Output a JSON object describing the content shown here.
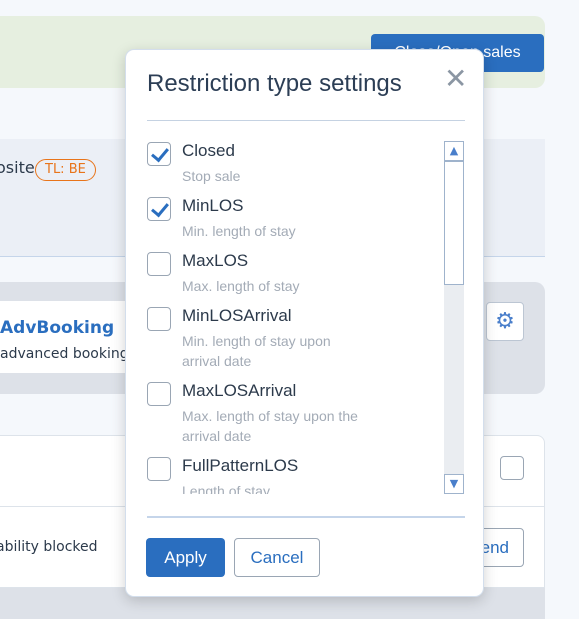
{
  "background": {
    "sales_button": "Close/Open sales",
    "site_text": "osite",
    "badge": "TL: BE",
    "card_title": "AdvBooking",
    "card_subtitle": "advanced booking",
    "row_text": "ability blocked",
    "row_button": "end",
    "gear_icon": "gear-icon"
  },
  "modal": {
    "title": "Restriction type settings",
    "close_icon": "close-icon",
    "items": [
      {
        "label": "Closed",
        "description": "Stop sale",
        "checked": true
      },
      {
        "label": "MinLOS",
        "description": "Min. length of stay",
        "checked": true
      },
      {
        "label": "MaxLOS",
        "description": "Max. length of stay",
        "checked": false
      },
      {
        "label": "MinLOSArrival",
        "description": "Min. length of stay upon arrival date",
        "checked": false
      },
      {
        "label": "MaxLOSArrival",
        "description": "Max. length of stay upon the arrival date",
        "checked": false
      },
      {
        "label": "FullPatternLOS",
        "description": "Length of stay",
        "checked": false
      }
    ],
    "apply_label": "Apply",
    "cancel_label": "Cancel"
  },
  "colors": {
    "accent": "#2a6ebf",
    "badge": "#e8741a"
  }
}
